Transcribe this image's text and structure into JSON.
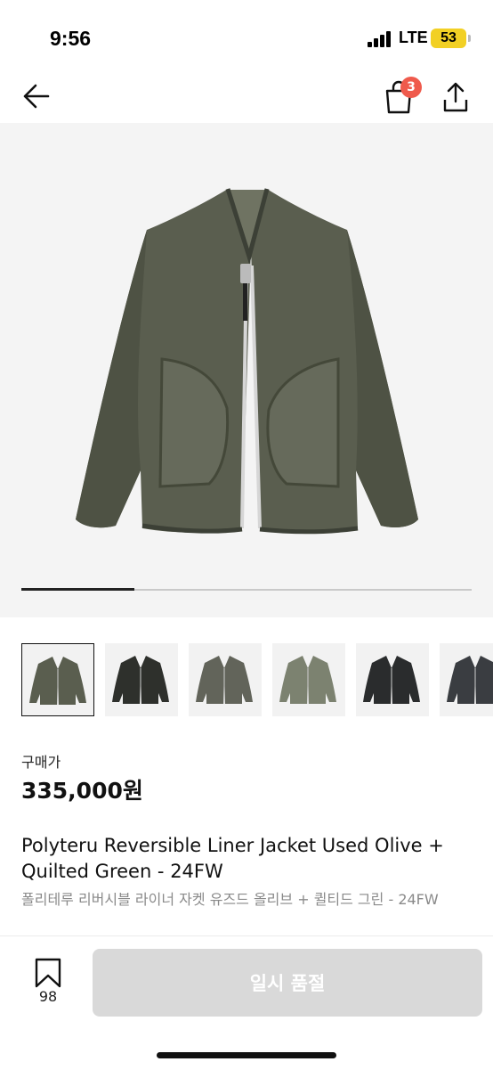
{
  "status": {
    "time": "9:56",
    "network": "LTE",
    "battery": "53",
    "icons": [
      "signal-icon",
      "battery-icon"
    ]
  },
  "nav": {
    "icons": [
      "back-arrow-icon",
      "shopping-bag-icon",
      "share-icon"
    ],
    "cart_count": "3"
  },
  "gallery": {
    "main_image": "olive jacket product photo",
    "progress": 0.25,
    "thumbnail_count": 6,
    "selected_index": 0,
    "thumbnail_colors": [
      "#5a5e4f",
      "#2e302c",
      "#62645a",
      "#7c8270",
      "#2a2c2d",
      "#3a3d41"
    ]
  },
  "product": {
    "price_label": "구매가",
    "price": "335,000원",
    "title_en": "Polyteru Reversible Liner Jacket Used Olive + Quilted Green - 24FW",
    "title_ko": "폴리테루 리버시블 라이너 자켓 유즈드 올리브 + 퀼티드 그린 - 24FW"
  },
  "actions": {
    "bookmark_icon": "bookmark-icon",
    "bookmark_count": "98",
    "button_label": "일시 품절"
  },
  "colors": {
    "badge": "#ef5a4c",
    "button_disabled": "#d9d9d9",
    "battery": "#f2d024"
  }
}
